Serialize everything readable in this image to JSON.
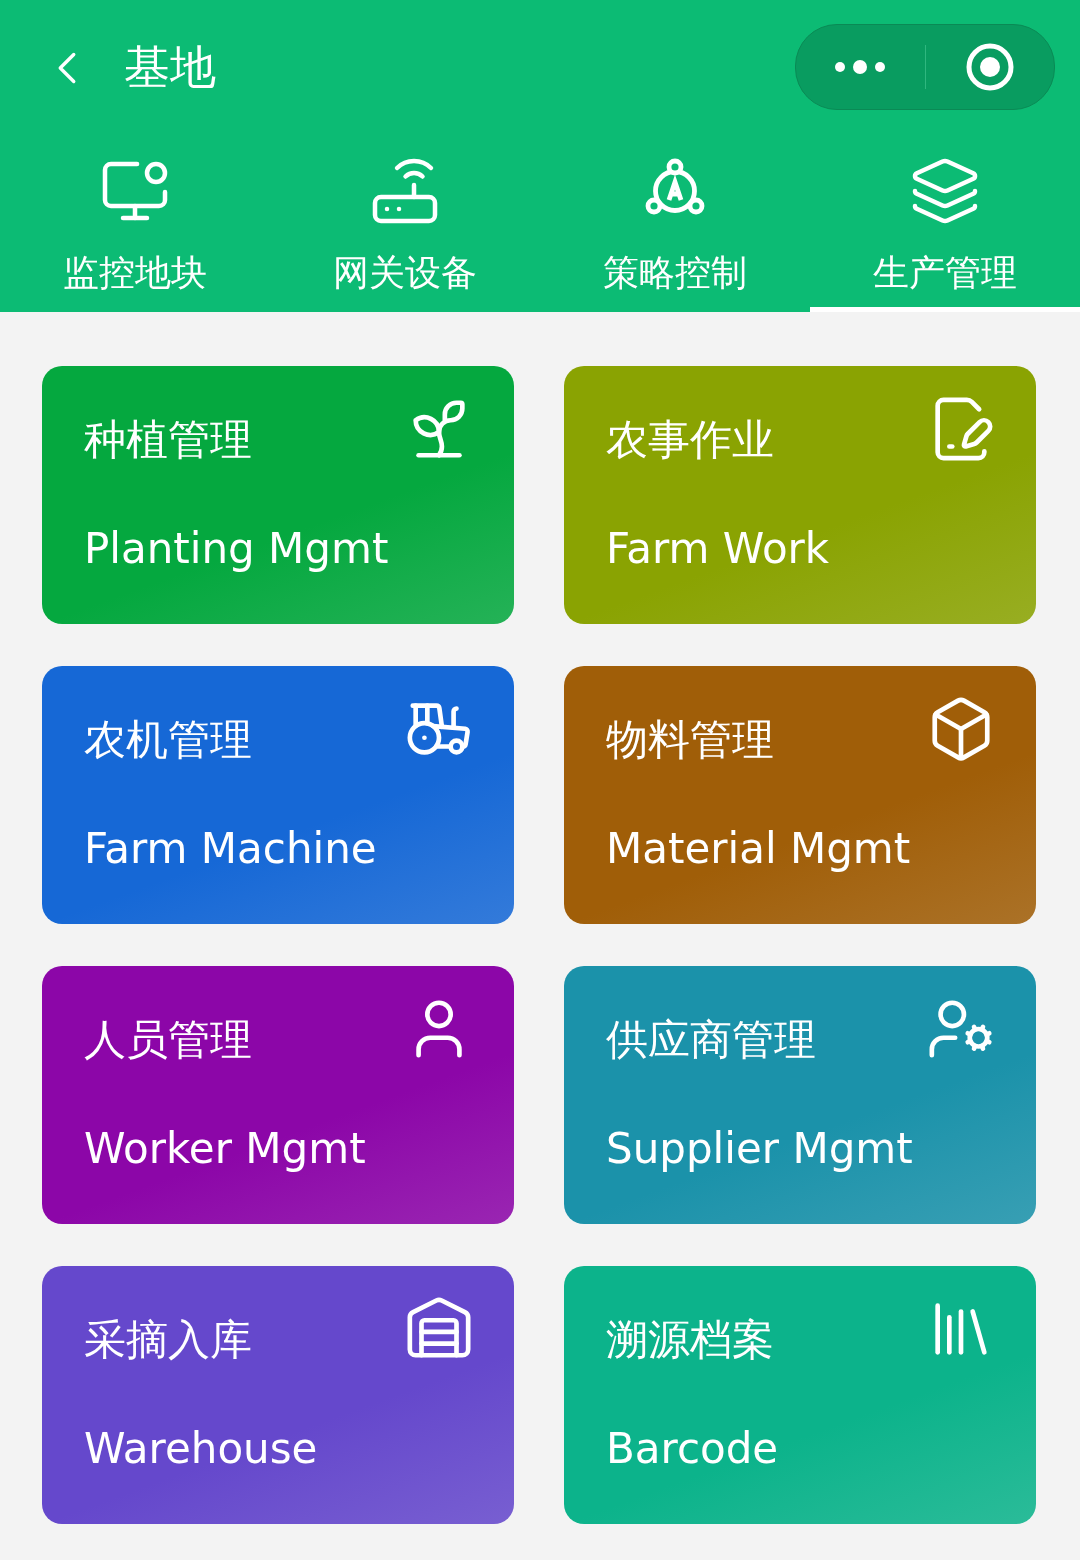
{
  "header": {
    "title": "基地"
  },
  "tabs": [
    {
      "label": "监控地块",
      "selected": false
    },
    {
      "label": "网关设备",
      "selected": false
    },
    {
      "label": "策略控制",
      "selected": false
    },
    {
      "label": "生产管理",
      "selected": true
    }
  ],
  "cards": [
    {
      "title": "种植管理",
      "subtitle": "Planting Mgmt",
      "color": "#05a83f"
    },
    {
      "title": "农事作业",
      "subtitle": "Farm Work",
      "color": "#8aa302"
    },
    {
      "title": "农机管理",
      "subtitle": "Farm Machine",
      "color": "#1668d6"
    },
    {
      "title": "物料管理",
      "subtitle": "Material Mgmt",
      "color": "#a05e08"
    },
    {
      "title": "人员管理",
      "subtitle": "Worker Mgmt",
      "color": "#8c06a8"
    },
    {
      "title": "供应商管理",
      "subtitle": "Supplier Mgmt",
      "color": "#1b92aa"
    },
    {
      "title": "采摘入库",
      "subtitle": "Warehouse",
      "color": "#6548cc"
    },
    {
      "title": "溯源档案",
      "subtitle": "Barcode",
      "color": "#0cb38b"
    }
  ]
}
